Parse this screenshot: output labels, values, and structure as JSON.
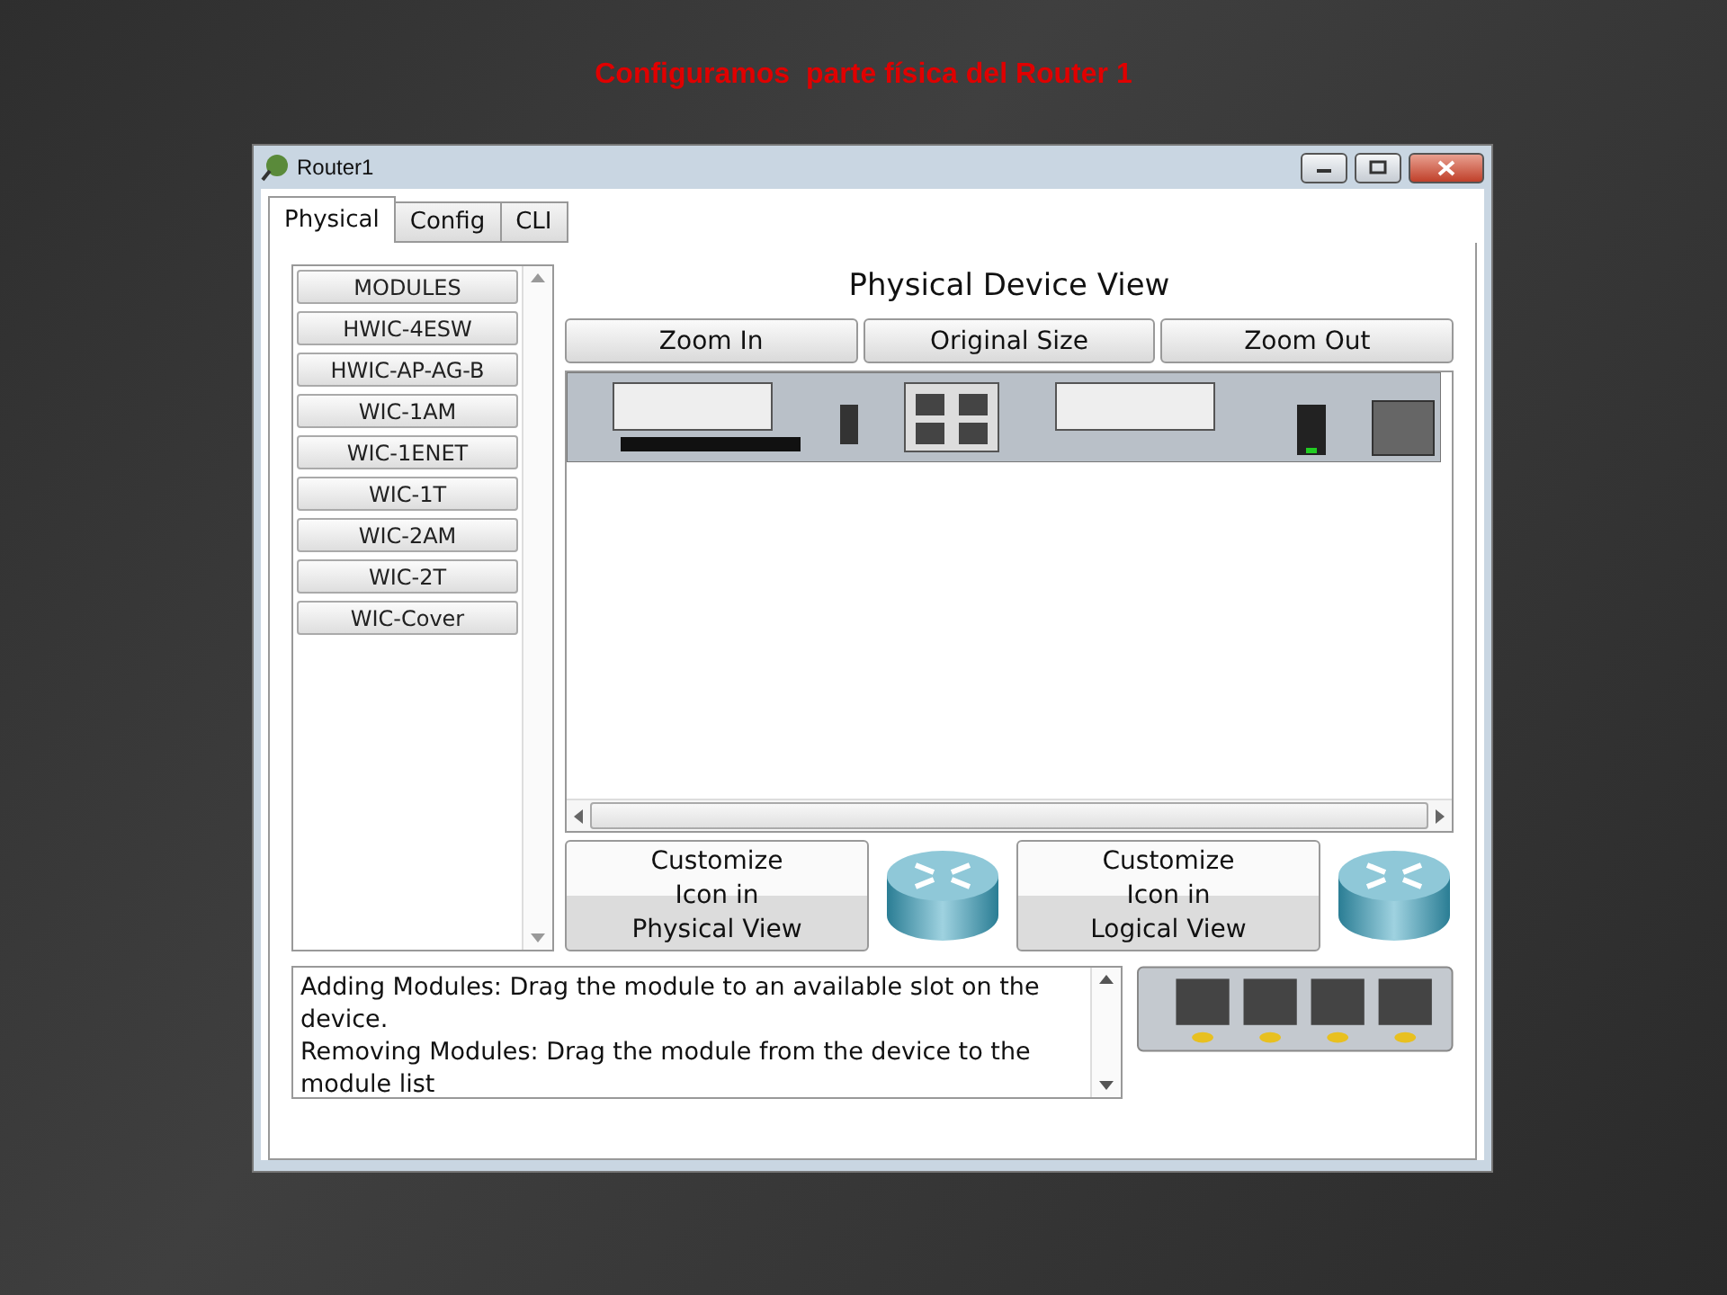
{
  "slide": {
    "title": "Configuramos  parte física del Router 1"
  },
  "window": {
    "title": "Router1"
  },
  "tabs": [
    {
      "label": "Physical",
      "selected": true
    },
    {
      "label": "Config",
      "selected": false
    },
    {
      "label": "CLI",
      "selected": false
    }
  ],
  "modules": [
    "MODULES",
    "HWIC-4ESW",
    "HWIC-AP-AG-B",
    "WIC-1AM",
    "WIC-1ENET",
    "WIC-1T",
    "WIC-2AM",
    "WIC-2T",
    "WIC-Cover"
  ],
  "device_view": {
    "title": "Physical Device View",
    "buttons": [
      "Zoom In",
      "Original Size",
      "Zoom Out"
    ]
  },
  "customize_buttons": [
    "Customize\nIcon in\nPhysical View",
    "Customize\nIcon in\nLogical View"
  ],
  "help": [
    "Adding Modules: Drag the module to an available slot on the device.",
    "Removing Modules: Drag the module from the device to the module list"
  ]
}
